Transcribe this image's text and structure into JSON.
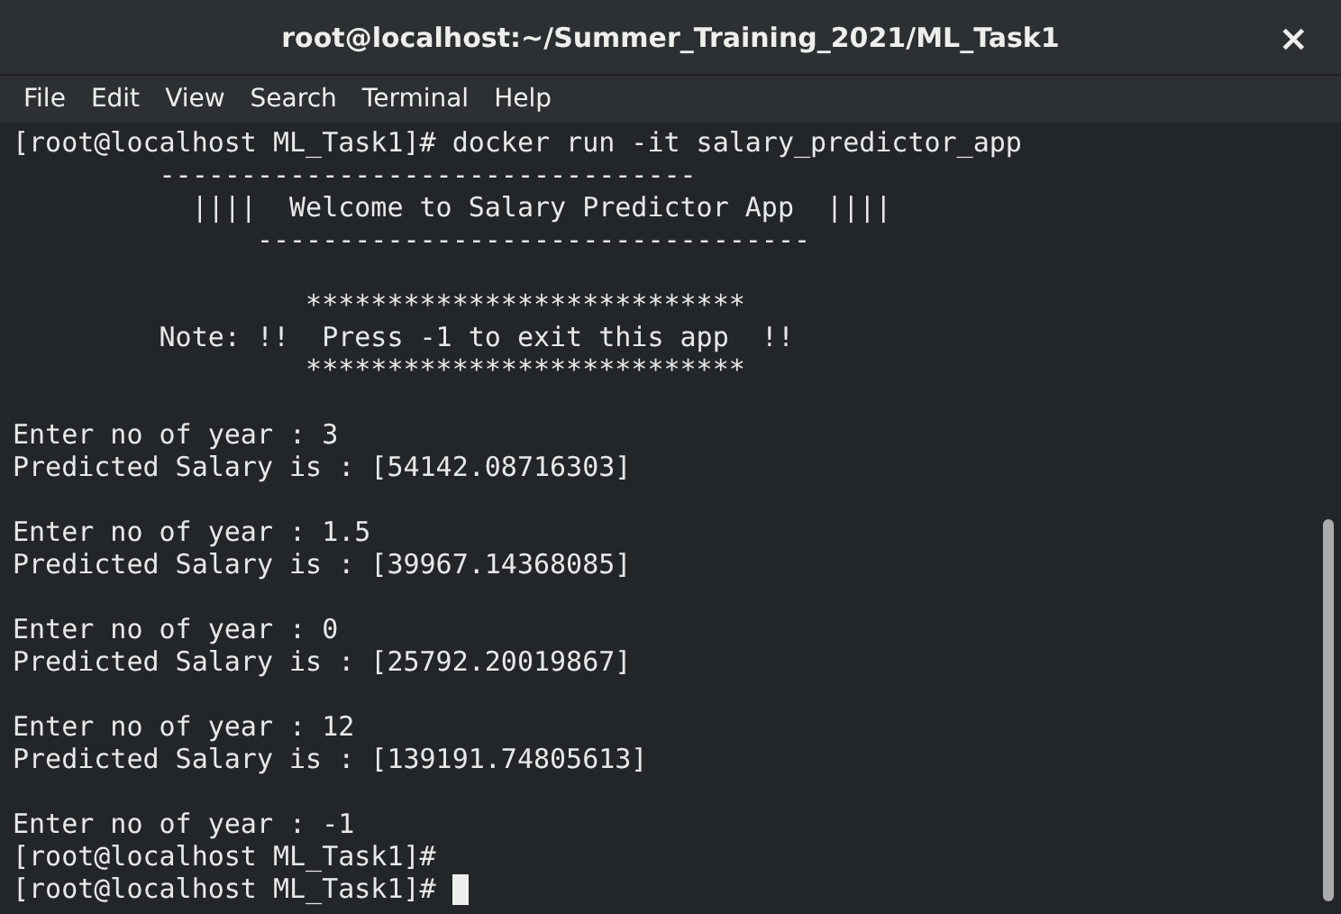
{
  "window": {
    "title": "root@localhost:~/Summer_Training_2021/ML_Task1",
    "close": "×"
  },
  "menu": [
    "File",
    "Edit",
    "View",
    "Search",
    "Terminal",
    "Help"
  ],
  "terminal": {
    "lines": [
      {
        "kind": "text",
        "text": "[root@localhost ML_Task1]# docker run -it salary_predictor_app"
      },
      {
        "kind": "text",
        "text": "         ---------------------------------"
      },
      {
        "kind": "text",
        "text": "           ||||  Welcome to Salary Predictor App  ||||"
      },
      {
        "kind": "text",
        "text": "               ----------------------------------"
      },
      {
        "kind": "blank"
      },
      {
        "kind": "text",
        "text": "                  ***************************"
      },
      {
        "kind": "text",
        "text": "         Note: !!  Press -1 to exit this app  !!"
      },
      {
        "kind": "text",
        "text": "                  ***************************"
      },
      {
        "kind": "blank"
      },
      {
        "kind": "text",
        "text": "Enter no of year : 3"
      },
      {
        "kind": "text",
        "text": "Predicted Salary is : [54142.08716303]"
      },
      {
        "kind": "blank"
      },
      {
        "kind": "text",
        "text": "Enter no of year : 1.5"
      },
      {
        "kind": "text",
        "text": "Predicted Salary is : [39967.14368085]"
      },
      {
        "kind": "blank"
      },
      {
        "kind": "text",
        "text": "Enter no of year : 0"
      },
      {
        "kind": "text",
        "text": "Predicted Salary is : [25792.20019867]"
      },
      {
        "kind": "blank"
      },
      {
        "kind": "text",
        "text": "Enter no of year : 12"
      },
      {
        "kind": "text",
        "text": "Predicted Salary is : [139191.74805613]"
      },
      {
        "kind": "blank"
      },
      {
        "kind": "text",
        "text": "Enter no of year : -1"
      },
      {
        "kind": "text",
        "text": "[root@localhost ML_Task1]#"
      },
      {
        "kind": "prompt",
        "text": "[root@localhost ML_Task1]#"
      }
    ]
  }
}
